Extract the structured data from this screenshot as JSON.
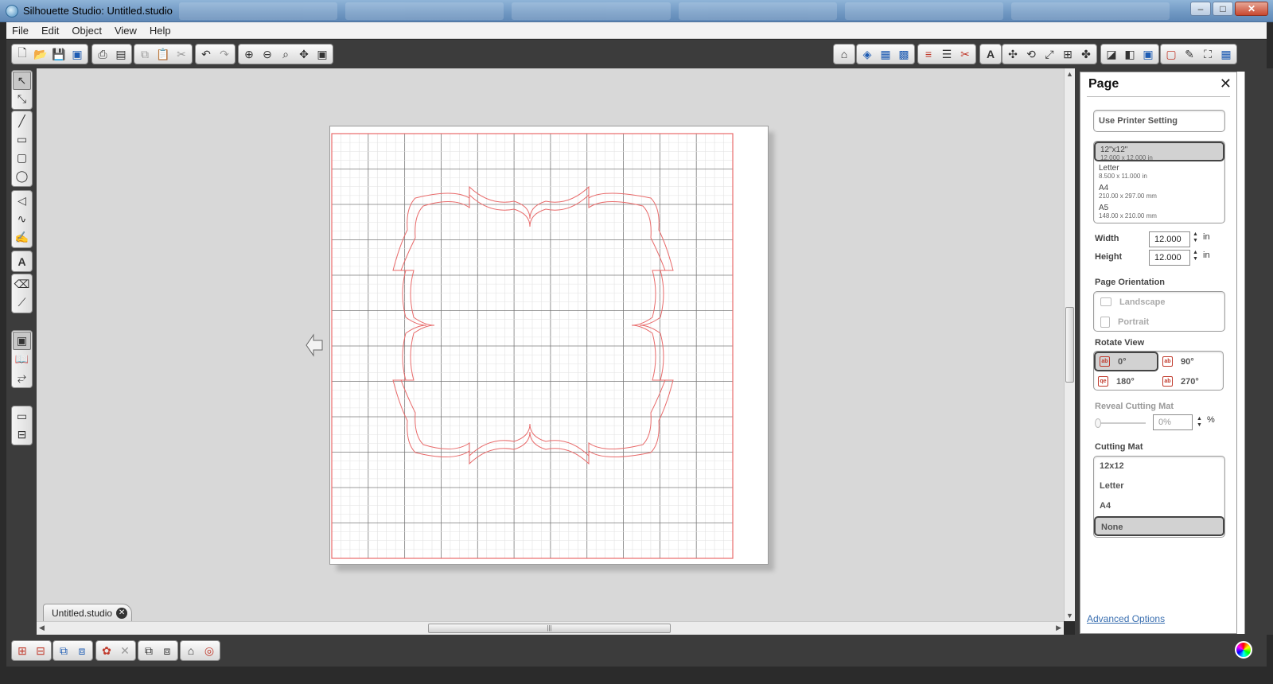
{
  "window": {
    "title": "Silhouette Studio: Untitled.studio",
    "controls": [
      "minimize",
      "maximize",
      "close"
    ]
  },
  "menu": [
    "File",
    "Edit",
    "Object",
    "View",
    "Help"
  ],
  "toolbar": {
    "left_icons": [
      "new-icon",
      "open-icon",
      "save-icon",
      "save-to-library-icon",
      "print-icon",
      "print-cut-icon",
      "copy-icon",
      "paste-icon",
      "cut-icon",
      "undo-icon",
      "redo-icon",
      "zoom-in-icon",
      "zoom-out-icon",
      "zoom-selected-icon",
      "pan-icon",
      "fit-page-icon"
    ],
    "right_icons": [
      "store-icon",
      "fill-color-icon",
      "fill-gradient-icon",
      "fill-pattern-icon",
      "line-color-icon",
      "line-style-icon",
      "cut-style-icon",
      "text-style-icon",
      "replicate-icon",
      "transform-rotate-icon",
      "scale-icon",
      "align-icon",
      "modify-icon",
      "page-settings-icon",
      "trace-icon",
      "registration-icon",
      "offset-icon",
      "sketch-icon",
      "fullscreen-icon",
      "grid-icon"
    ]
  },
  "document_tab": {
    "label": "Untitled.studio"
  },
  "page_panel": {
    "title": "Page",
    "use_printer_setting": "Use Printer Setting",
    "sizes": [
      {
        "name": "12\"x12\"",
        "dims": "12.000 x 12.000 in",
        "selected": true
      },
      {
        "name": "Letter",
        "dims": "8.500 x 11.000 in",
        "selected": false
      },
      {
        "name": "A4",
        "dims": "210.00 x 297.00 mm",
        "selected": false
      },
      {
        "name": "A5",
        "dims": "148.00 x 210.00 mm",
        "selected": false
      }
    ],
    "width_label": "Width",
    "width_value": "12.000",
    "height_label": "Height",
    "height_value": "12.000",
    "unit": "in",
    "orientation_label": "Page Orientation",
    "orientations": [
      "Landscape",
      "Portrait"
    ],
    "rotate_label": "Rotate View",
    "rotations": [
      {
        "label": "0°",
        "selected": true
      },
      {
        "label": "90°",
        "selected": false
      },
      {
        "label": "180°",
        "selected": false
      },
      {
        "label": "270°",
        "selected": false
      }
    ],
    "reveal_label": "Reveal Cutting Mat",
    "reveal_value": "0%",
    "percent_sign": "%",
    "cutting_mat_label": "Cutting Mat",
    "cutting_mats": [
      {
        "label": "12x12",
        "selected": false
      },
      {
        "label": "Letter",
        "selected": false
      },
      {
        "label": "A4",
        "selected": false
      },
      {
        "label": "None",
        "selected": true
      }
    ],
    "advanced_options": "Advanced Options"
  },
  "colors": {
    "grid_minor": "#e2e2e2",
    "grid_major": "#7a7a7a",
    "cut_line": "#e86a6a",
    "panel_selected": "#d2d2d2"
  }
}
